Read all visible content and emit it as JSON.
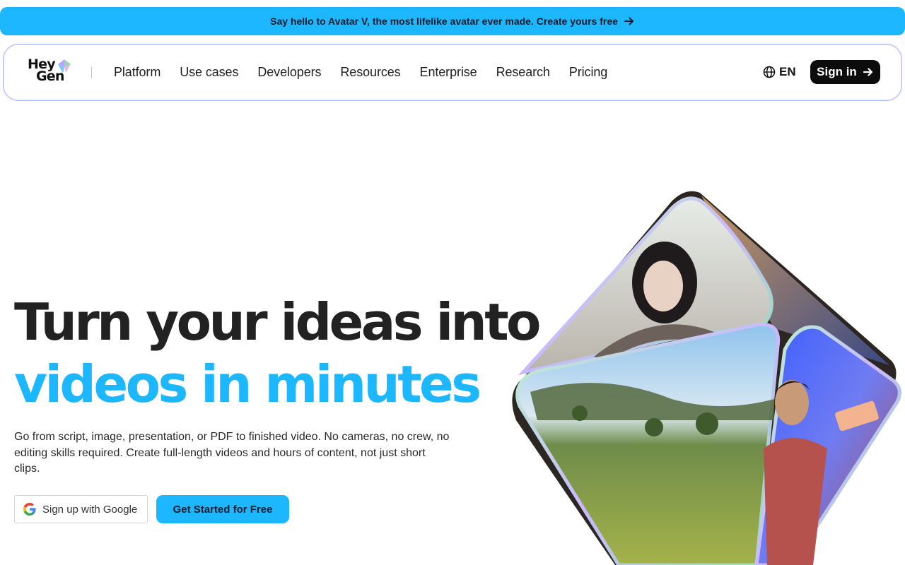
{
  "announcement": {
    "text": "Say hello to Avatar V, the most lifelike avatar ever made. Create yours free",
    "arrow_icon": "arrow-right-icon"
  },
  "nav": {
    "logo": {
      "line1": "Hey",
      "line2": "Gen"
    },
    "links": [
      "Platform",
      "Use cases",
      "Developers",
      "Resources",
      "Enterprise",
      "Research",
      "Pricing"
    ],
    "language": {
      "icon": "globe-icon",
      "label": "EN"
    },
    "signin": {
      "label": "Sign in",
      "icon": "arrow-right-icon"
    }
  },
  "hero": {
    "headline_line1": "Turn your ideas into",
    "headline_line2": "videos in minutes",
    "subtext": "Go from script, image, presentation, or PDF to finished video. No cameras, no crew, no editing skills required. Create full-length videos and hours of content, not just short clips.",
    "google_button": {
      "label": "Sign up with Google",
      "icon": "google-icon"
    },
    "cta_button": {
      "label": "Get Started for Free"
    }
  },
  "colors": {
    "accent": "#1cb7ff",
    "text_dark": "#222222",
    "button_dark": "#0c0c0c"
  }
}
